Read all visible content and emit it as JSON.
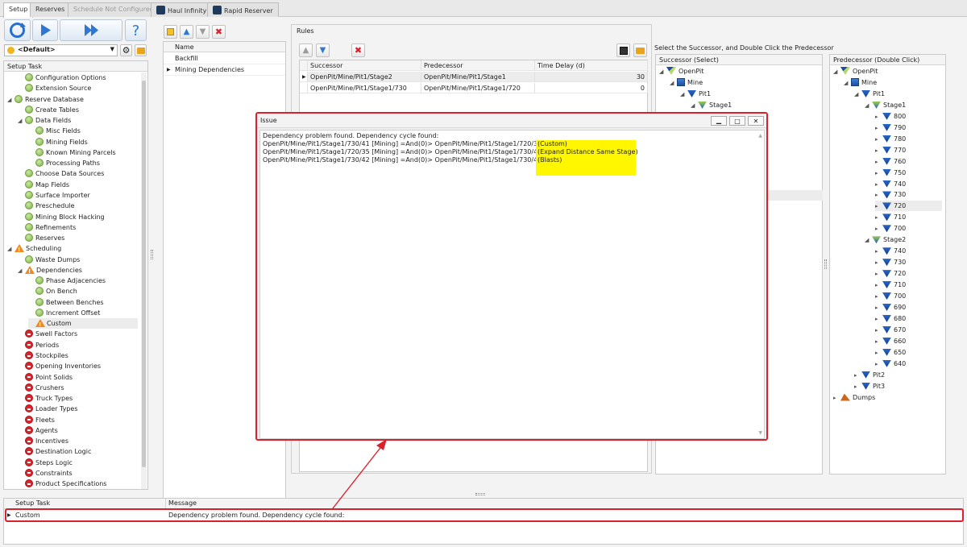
{
  "tabs": [
    {
      "label": "Setup",
      "state": "active"
    },
    {
      "label": "Reserves",
      "state": "normal"
    },
    {
      "label": "Schedule Not Configured",
      "state": "disabled"
    },
    {
      "label": "Haul Infinity",
      "state": "normal",
      "icon": "haul-infinity-icon"
    },
    {
      "label": "Rapid Reserver",
      "state": "normal",
      "icon": "rapid-reserver-icon"
    }
  ],
  "toolbar": {
    "refresh_icon": "refresh-icon",
    "run_icon": "play-icon",
    "fast_forward_icon": "fast-forward-icon",
    "help_icon": "help-icon",
    "profile_value": "<Default>"
  },
  "setup_task": {
    "header": "Setup Task",
    "items": [
      {
        "label": "Configuration Options",
        "status": "ok",
        "level": 1
      },
      {
        "label": "Extension Source",
        "status": "ok",
        "level": 1
      },
      {
        "label": "Reserve Database",
        "status": "ok",
        "level": 0,
        "expanded": true
      },
      {
        "label": "Create Tables",
        "status": "ok",
        "level": 1
      },
      {
        "label": "Data Fields",
        "status": "ok",
        "level": 1,
        "expanded": true
      },
      {
        "label": "Misc Fields",
        "status": "ok",
        "level": 2
      },
      {
        "label": "Mining Fields",
        "status": "ok",
        "level": 2
      },
      {
        "label": "Known Mining Parcels",
        "status": "ok",
        "level": 2
      },
      {
        "label": "Processing Paths",
        "status": "ok",
        "level": 2
      },
      {
        "label": "Choose Data Sources",
        "status": "ok",
        "level": 1
      },
      {
        "label": "Map Fields",
        "status": "ok",
        "level": 1
      },
      {
        "label": "Surface Importer",
        "status": "ok",
        "level": 1
      },
      {
        "label": "Preschedule",
        "status": "ok",
        "level": 1
      },
      {
        "label": "Mining Block Hacking",
        "status": "ok",
        "level": 1
      },
      {
        "label": "Refinements",
        "status": "ok",
        "level": 1
      },
      {
        "label": "Reserves",
        "status": "ok",
        "level": 1
      },
      {
        "label": "Scheduling",
        "status": "warn",
        "level": 0,
        "expanded": true
      },
      {
        "label": "Waste Dumps",
        "status": "ok",
        "level": 1
      },
      {
        "label": "Dependencies",
        "status": "warn",
        "level": 1,
        "expanded": true
      },
      {
        "label": "Phase Adjacencies",
        "status": "ok",
        "level": 2
      },
      {
        "label": "On Bench",
        "status": "ok",
        "level": 2
      },
      {
        "label": "Between Benches",
        "status": "ok",
        "level": 2
      },
      {
        "label": "Increment Offset",
        "status": "ok",
        "level": 2
      },
      {
        "label": "Custom",
        "status": "warn",
        "level": 2,
        "selected": true
      },
      {
        "label": "Swell Factors",
        "status": "no",
        "level": 1
      },
      {
        "label": "Periods",
        "status": "no",
        "level": 1
      },
      {
        "label": "Stockpiles",
        "status": "no",
        "level": 1
      },
      {
        "label": "Opening Inventories",
        "status": "no",
        "level": 1
      },
      {
        "label": "Point Solids",
        "status": "no",
        "level": 1
      },
      {
        "label": "Crushers",
        "status": "no",
        "level": 1
      },
      {
        "label": "Truck Types",
        "status": "no",
        "level": 1
      },
      {
        "label": "Loader Types",
        "status": "no",
        "level": 1
      },
      {
        "label": "Fleets",
        "status": "no",
        "level": 1
      },
      {
        "label": "Agents",
        "status": "no",
        "level": 1
      },
      {
        "label": "Incentives",
        "status": "no",
        "level": 1
      },
      {
        "label": "Destination Logic",
        "status": "no",
        "level": 1
      },
      {
        "label": "Steps Logic",
        "status": "no",
        "level": 1
      },
      {
        "label": "Constraints",
        "status": "no",
        "level": 1
      },
      {
        "label": "Product Specifications",
        "status": "no",
        "level": 1
      }
    ]
  },
  "name_list": {
    "header": "Name",
    "items": [
      "Backfill",
      "Mining Dependencies"
    ]
  },
  "rules": {
    "title": "Rules",
    "columns": [
      "Successor",
      "Predecessor",
      "Time Delay (d)"
    ],
    "rows": [
      {
        "successor": "OpenPit/Mine/Pit1/Stage2",
        "predecessor": "OpenPit/Mine/Pit1/Stage1",
        "delay": "30"
      },
      {
        "successor": "OpenPit/Mine/Pit1/Stage1/730",
        "predecessor": "OpenPit/Mine/Pit1/Stage1/720",
        "delay": "0"
      }
    ]
  },
  "instruction": "Select the Successor, and Double Click the Predecessor",
  "successor_tree": {
    "header": "Successor (Select)",
    "items": [
      {
        "label": "OpenPit",
        "level": 0,
        "icon": "openpit-icon"
      },
      {
        "label": "Mine",
        "level": 1,
        "icon": "mine-icon"
      },
      {
        "label": "Pit1",
        "level": 2,
        "icon": "pit-icon"
      },
      {
        "label": "Stage1",
        "level": 3,
        "icon": "stage-icon"
      }
    ]
  },
  "predecessor_tree": {
    "header": "Predecessor (Double Click)",
    "items": [
      {
        "label": "OpenPit",
        "level": 0,
        "icon": "openpit-icon",
        "exp": "open"
      },
      {
        "label": "Mine",
        "level": 1,
        "icon": "mine-icon",
        "exp": "open"
      },
      {
        "label": "Pit1",
        "level": 2,
        "icon": "pit-icon",
        "exp": "open"
      },
      {
        "label": "Stage1",
        "level": 3,
        "icon": "stage-icon",
        "exp": "open"
      },
      {
        "label": "800",
        "level": 4,
        "icon": "bench-icon",
        "exp": "closed"
      },
      {
        "label": "790",
        "level": 4,
        "icon": "bench-icon",
        "exp": "closed"
      },
      {
        "label": "780",
        "level": 4,
        "icon": "bench-icon",
        "exp": "closed"
      },
      {
        "label": "770",
        "level": 4,
        "icon": "bench-icon",
        "exp": "closed"
      },
      {
        "label": "760",
        "level": 4,
        "icon": "bench-icon",
        "exp": "closed"
      },
      {
        "label": "750",
        "level": 4,
        "icon": "bench-icon",
        "exp": "closed"
      },
      {
        "label": "740",
        "level": 4,
        "icon": "bench-icon",
        "exp": "closed"
      },
      {
        "label": "730",
        "level": 4,
        "icon": "bench-icon",
        "exp": "closed"
      },
      {
        "label": "720",
        "level": 4,
        "icon": "bench-icon",
        "exp": "closed",
        "selected": true
      },
      {
        "label": "710",
        "level": 4,
        "icon": "bench-icon",
        "exp": "closed"
      },
      {
        "label": "700",
        "level": 4,
        "icon": "bench-icon",
        "exp": "closed"
      },
      {
        "label": "Stage2",
        "level": 3,
        "icon": "stage-icon",
        "exp": "open"
      },
      {
        "label": "740",
        "level": 4,
        "icon": "bench-icon",
        "exp": "closed"
      },
      {
        "label": "730",
        "level": 4,
        "icon": "bench-icon",
        "exp": "closed"
      },
      {
        "label": "720",
        "level": 4,
        "icon": "bench-icon",
        "exp": "closed"
      },
      {
        "label": "710",
        "level": 4,
        "icon": "bench-icon",
        "exp": "closed"
      },
      {
        "label": "700",
        "level": 4,
        "icon": "bench-icon",
        "exp": "closed"
      },
      {
        "label": "690",
        "level": 4,
        "icon": "bench-icon",
        "exp": "closed"
      },
      {
        "label": "680",
        "level": 4,
        "icon": "bench-icon",
        "exp": "closed"
      },
      {
        "label": "670",
        "level": 4,
        "icon": "bench-icon",
        "exp": "closed"
      },
      {
        "label": "660",
        "level": 4,
        "icon": "bench-icon",
        "exp": "closed"
      },
      {
        "label": "650",
        "level": 4,
        "icon": "bench-icon",
        "exp": "closed"
      },
      {
        "label": "640",
        "level": 4,
        "icon": "bench-icon",
        "exp": "closed"
      },
      {
        "label": "Pit2",
        "level": 2,
        "icon": "pit-icon",
        "exp": "closed"
      },
      {
        "label": "Pit3",
        "level": 2,
        "icon": "pit-icon",
        "exp": "closed"
      },
      {
        "label": "Dumps",
        "level": 0,
        "icon": "dumps-icon",
        "exp": "closed"
      }
    ]
  },
  "issue_dialog": {
    "title": "Issue",
    "lines": [
      {
        "text": "Dependency problem found. Dependency cycle found:",
        "tag": ""
      },
      {
        "text": "OpenPit/Mine/Pit1/Stage1/730/41 [Mining]  =And(0)> OpenPit/Mine/Pit1/Stage1/720/35 [Mining]",
        "tag": "(Custom)"
      },
      {
        "text": "OpenPit/Mine/Pit1/Stage1/720/35 [Mining]  =And(0)> OpenPit/Mine/Pit1/Stage1/730/42 [Mining]",
        "tag": "(Expand Distance Same Stage)"
      },
      {
        "text": "OpenPit/Mine/Pit1/Stage1/730/42 [Mining]  =And(0)> OpenPit/Mine/Pit1/Stage1/730/41 [Mining]",
        "tag": "(Blasts)"
      }
    ],
    "highlight_color": "#fff700",
    "border_color": "#d9212b"
  },
  "messages": {
    "columns": [
      "Setup Task",
      "Message"
    ],
    "rows": [
      {
        "task": "Custom",
        "message": "Dependency problem found. Dependency cycle found:"
      }
    ]
  }
}
